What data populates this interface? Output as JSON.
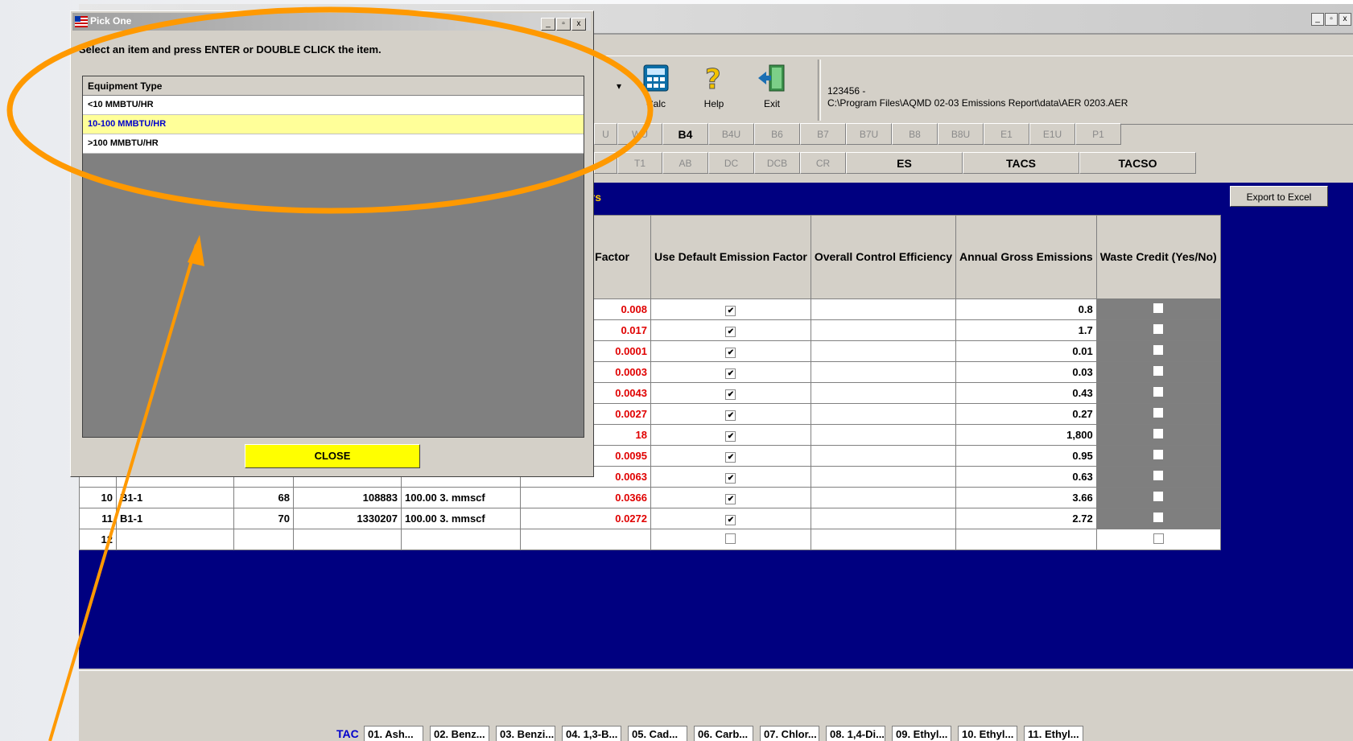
{
  "toolbar": {
    "calc_label": "Calc",
    "help_label": "Help",
    "exit_label": "Exit",
    "dropdown_arrow": "▾",
    "file_id": "123456 -",
    "file_path": "C:\\Program Files\\AQMD 02-03 Emissions Report\\data\\AER 0203.AER"
  },
  "window_controls": {
    "minimize": "_",
    "maximize": "▫",
    "close": "x"
  },
  "tabs_row1": [
    "U",
    "WU",
    "B4",
    "B4U",
    "B6",
    "B7",
    "B7U",
    "B8",
    "B8U",
    "E1",
    "E1U",
    "P1"
  ],
  "tabs_row2": [
    "",
    "T1",
    "AB",
    "DC",
    "DCB",
    "CR",
    "ES",
    "TACS",
    "TACSO"
  ],
  "section_title": "ers",
  "export_label": "Export to Excel",
  "grid": {
    "headers": {
      "emission_factor": "Emission Factor",
      "use_default": "Use Default Emission Factor",
      "control_eff": "Overall Control Efficiency",
      "annual_gross": "Annual Gross Emissions",
      "waste_credit": "Waste Credit (Yes/No)"
    },
    "rows": [
      {
        "n": "",
        "eq": "",
        "code": "",
        "amount": "",
        "unit": "",
        "ef": "0.008",
        "checked": true,
        "gross": "0.8"
      },
      {
        "n": "",
        "eq": "",
        "code": "",
        "amount": "",
        "unit": "",
        "ef": "0.017",
        "checked": true,
        "gross": "1.7"
      },
      {
        "n": "",
        "eq": "",
        "code": "",
        "amount": "",
        "unit": "",
        "ef": "0.0001",
        "checked": true,
        "gross": "0.01"
      },
      {
        "n": "",
        "eq": "",
        "code": "",
        "amount": "",
        "unit": "",
        "ef": "0.0003",
        "checked": true,
        "gross": "0.03"
      },
      {
        "n": "",
        "eq": "",
        "code": "",
        "amount": "",
        "unit": "",
        "ef": "0.0043",
        "checked": true,
        "gross": "0.43"
      },
      {
        "n": "",
        "eq": "",
        "code": "",
        "amount": "",
        "unit": "",
        "ef": "0.0027",
        "checked": true,
        "gross": "0.27"
      },
      {
        "n": "",
        "eq": "",
        "code": "",
        "amount": "",
        "unit": "",
        "ef": "18",
        "checked": true,
        "gross": "1,800"
      },
      {
        "n": "",
        "eq": "",
        "code": "",
        "amount": "",
        "unit": "",
        "ef": "0.0095",
        "checked": true,
        "gross": "0.95"
      },
      {
        "n": "",
        "eq": "",
        "code": "",
        "amount": "",
        "unit": "",
        "ef": "0.0063",
        "checked": true,
        "gross": "0.63"
      },
      {
        "n": "10",
        "eq": "B1-1",
        "code": "68",
        "amount": "108883",
        "unit": "100.00 3. mmscf",
        "ef": "0.0366",
        "checked": true,
        "gross": "3.66"
      },
      {
        "n": "11",
        "eq": "B1-1",
        "code": "70",
        "amount": "1330207",
        "unit": "100.00 3. mmscf",
        "ef": "0.0272",
        "checked": true,
        "gross": "2.72"
      },
      {
        "n": "12",
        "eq": "",
        "code": "",
        "amount": "",
        "unit": "",
        "ef": "",
        "checked": false,
        "gross": "",
        "empty": true
      }
    ]
  },
  "tac_bar": {
    "label": "TAC",
    "items": [
      "01. Ash...",
      "02. Benz...",
      "03. Benzi...",
      "04. 1,3-B...",
      "05. Cad...",
      "06. Carb...",
      "07. Chlor...",
      "08. 1,4-Di...",
      "09. Ethyl...",
      "10. Ethyl...",
      "11. Ethyl..."
    ]
  },
  "dialog": {
    "title": "Pick One",
    "instruction": "Select an item and press ENTER or DOUBLE CLICK the item.",
    "list_header": "Equipment Type",
    "items": [
      "<10 MMBTU/HR",
      "10-100 MMBTU/HR",
      ">100 MMBTU/HR"
    ],
    "selected_index": 1,
    "close_label": "CLOSE"
  },
  "colors": {
    "annotation": "#ff9900",
    "content_bg": "#000080",
    "emission_factor_text": "#e00000",
    "section_title": "#ffcc00",
    "close_button": "#ffff00",
    "selected_row": "#ffff99"
  }
}
